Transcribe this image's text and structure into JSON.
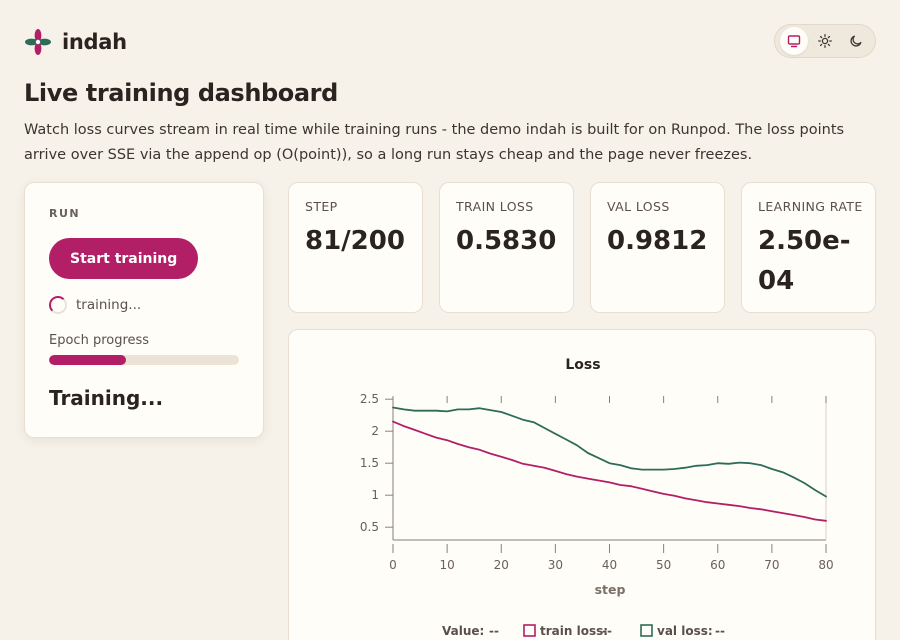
{
  "brand": {
    "name": "indah",
    "accent": "#b31f66",
    "secondary": "#2e6b5a"
  },
  "theme_switch": {
    "options": [
      {
        "icon": "monitor-icon",
        "active": true
      },
      {
        "icon": "sun-icon",
        "active": false
      },
      {
        "icon": "moon-icon",
        "active": false
      }
    ]
  },
  "page": {
    "title": "Live training dashboard",
    "description": "Watch loss curves stream in real time while training runs - the demo indah is built for on Runpod. The loss points arrive over SSE via the append op (O(point)), so a long run stays cheap and the page never freezes."
  },
  "run": {
    "label": "RUN",
    "button": "Start training",
    "status": "training...",
    "progress_label": "Epoch progress",
    "progress": 0.405,
    "state": "Training..."
  },
  "stats": [
    {
      "label": "STEP",
      "value": "81/200"
    },
    {
      "label": "TRAIN LOSS",
      "value": "0.5830"
    },
    {
      "label": "VAL LOSS",
      "value": "0.9812"
    },
    {
      "label": "LEARNING RATE",
      "value": "2.50e-04"
    }
  ],
  "chart_data": {
    "type": "line",
    "title": "Loss",
    "xlabel": "step",
    "ylabel": "",
    "xlim": [
      0,
      80
    ],
    "ylim": [
      0.3,
      2.55
    ],
    "xticks": [
      "0",
      "10",
      "20",
      "30",
      "40",
      "50",
      "60",
      "70",
      "80"
    ],
    "yticks": [
      "0.5",
      "1",
      "1.5",
      "2",
      "2.5"
    ],
    "grid": false,
    "legend": {
      "value_label": "Value:",
      "value": "--",
      "position": "bottom"
    },
    "series": [
      {
        "name": "train loss",
        "legend_value": "--",
        "color": "#b31f66",
        "x": [
          0,
          2,
          4,
          6,
          8,
          10,
          12,
          14,
          16,
          18,
          20,
          22,
          24,
          26,
          28,
          30,
          32,
          34,
          36,
          38,
          40,
          42,
          44,
          46,
          48,
          50,
          52,
          54,
          56,
          58,
          60,
          62,
          64,
          66,
          68,
          70,
          72,
          74,
          76,
          78,
          80
        ],
        "y": [
          2.15,
          2.08,
          2.02,
          1.96,
          1.9,
          1.86,
          1.8,
          1.75,
          1.71,
          1.65,
          1.6,
          1.55,
          1.49,
          1.46,
          1.43,
          1.38,
          1.33,
          1.29,
          1.26,
          1.23,
          1.2,
          1.16,
          1.14,
          1.1,
          1.06,
          1.02,
          0.99,
          0.95,
          0.92,
          0.89,
          0.87,
          0.85,
          0.83,
          0.8,
          0.78,
          0.75,
          0.72,
          0.69,
          0.66,
          0.62,
          0.6
        ]
      },
      {
        "name": "val loss",
        "legend_value": "--",
        "color": "#2e6b5a",
        "x": [
          0,
          2,
          4,
          6,
          8,
          10,
          12,
          14,
          16,
          18,
          20,
          22,
          24,
          26,
          28,
          30,
          32,
          34,
          36,
          38,
          40,
          42,
          44,
          46,
          48,
          50,
          52,
          54,
          56,
          58,
          60,
          62,
          64,
          66,
          68,
          70,
          72,
          74,
          76,
          78,
          80
        ],
        "y": [
          2.37,
          2.34,
          2.32,
          2.32,
          2.32,
          2.31,
          2.34,
          2.34,
          2.36,
          2.33,
          2.3,
          2.24,
          2.18,
          2.14,
          2.05,
          1.96,
          1.87,
          1.78,
          1.66,
          1.58,
          1.5,
          1.47,
          1.42,
          1.4,
          1.4,
          1.4,
          1.41,
          1.43,
          1.46,
          1.47,
          1.5,
          1.49,
          1.51,
          1.5,
          1.47,
          1.41,
          1.36,
          1.28,
          1.19,
          1.08,
          0.98
        ]
      }
    ]
  }
}
